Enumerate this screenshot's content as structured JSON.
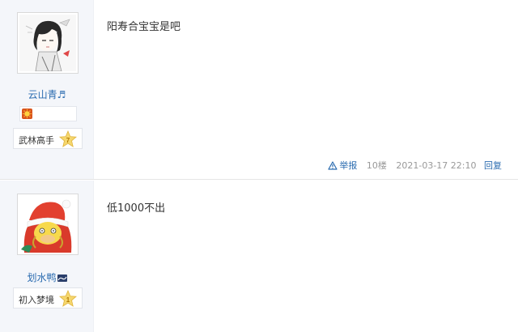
{
  "posts": [
    {
      "username": "云山青♬",
      "rank_title": "武林高手",
      "rank_level": "7",
      "content": "阳寿合宝宝是吧",
      "meta": {
        "report_label": "举报",
        "floor": "10楼",
        "time": "2021-03-17 22:10",
        "reply_label": "回复"
      }
    },
    {
      "username": "划水鸭",
      "rank_title": "初入梦境",
      "rank_level": "1",
      "content": "低1000不出"
    }
  ],
  "icons": {
    "report": "warning-triangle-icon",
    "medal": "sun-medal-icon",
    "rank_badge": "star-badge-icon"
  },
  "colors": {
    "link": "#2b6cb0",
    "sidebar": "#f4f6fa",
    "badge": "#f2c94c"
  }
}
